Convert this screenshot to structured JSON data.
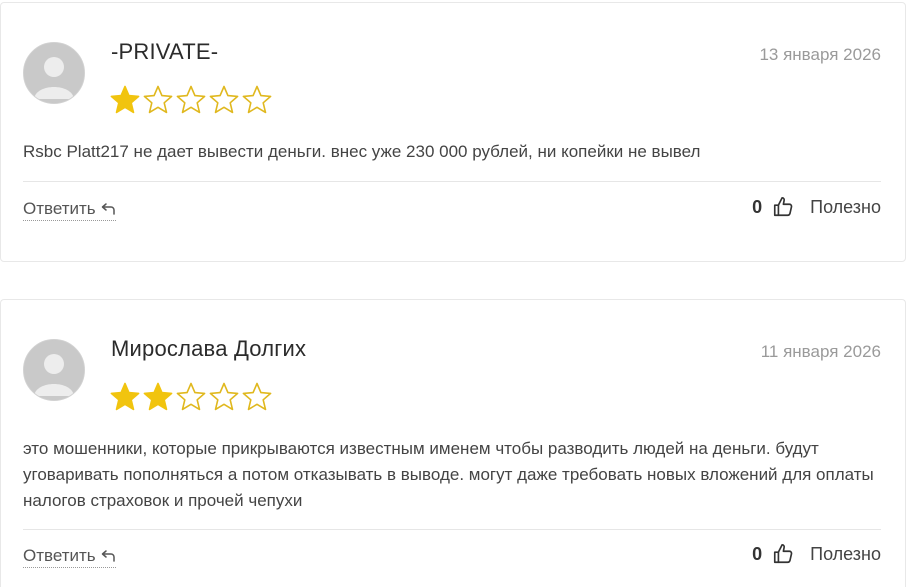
{
  "colors": {
    "star_filled": "#f1c40f",
    "star_empty_stroke": "#e0b81e",
    "date": "#9a9a9a",
    "divider": "#e6e6e6"
  },
  "reviews": [
    {
      "author": "-PRIVATE-",
      "date": "13 января 2026",
      "rating": 1,
      "max_rating": 5,
      "text": "Rsbc Platt217 не дает вывести деньги. внес уже 230 000 рублей, ни копейки не вывел",
      "reply_label": "Ответить",
      "helpful_count": "0",
      "helpful_label": "Полезно",
      "icons": [
        "avatar-placeholder",
        "reply-arrow-icon",
        "thumbs-up-icon"
      ]
    },
    {
      "author": "Мирослава Долгих",
      "date": "11 января 2026",
      "rating": 2,
      "max_rating": 5,
      "text": "это мошенники, которые прикрываются известным именем чтобы разводить людей на деньги. будут уговаривать пополняться а потом отказывать в выводе. могут даже требовать новых вложений для оплаты налогов страховок и прочей чепухи",
      "reply_label": "Ответить",
      "helpful_count": "0",
      "helpful_label": "Полезно",
      "icons": [
        "avatar-placeholder",
        "reply-arrow-icon",
        "thumbs-up-icon"
      ]
    }
  ]
}
